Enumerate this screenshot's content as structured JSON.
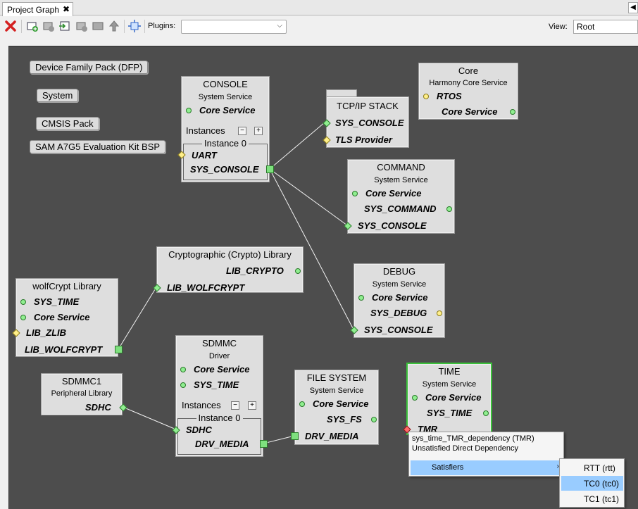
{
  "tab": {
    "title": "Project Graph",
    "close": "✖",
    "overflow": "◀"
  },
  "toolbar": {
    "plugins_label": "Plugins:",
    "plugins_value": "",
    "view_label": "View:",
    "view_value": "Root"
  },
  "top_pills": [
    "Device Family Pack (DFP)",
    "System",
    "CMSIS Pack",
    "SAM A7G5 Evaluation Kit BSP"
  ],
  "nodes": {
    "console": {
      "title": "CONSOLE",
      "subtitle": "System Service",
      "core": "Core Service",
      "instances": "Instances",
      "instance0": "Instance 0",
      "uart": "UART",
      "sys_console": "SYS_CONSOLE"
    },
    "tcpip": {
      "title": "TCP/IP STACK",
      "sys_console": "SYS_CONSOLE",
      "tls": "TLS Provider"
    },
    "core": {
      "title": "Core",
      "subtitle": "Harmony Core Service",
      "rtos": "RTOS",
      "core": "Core Service"
    },
    "command": {
      "title": "COMMAND",
      "subtitle": "System Service",
      "core": "Core Service",
      "sys_command": "SYS_COMMAND",
      "sys_console": "SYS_CONSOLE"
    },
    "crypto": {
      "title": "Cryptographic (Crypto) Library",
      "lib_crypto": "LIB_CRYPTO",
      "lib_wolfcrypt": "LIB_WOLFCRYPT"
    },
    "wolfcrypt": {
      "title": "wolfCrypt Library",
      "sys_time": "SYS_TIME",
      "core": "Core Service",
      "lib_zlib": "LIB_ZLIB",
      "lib_wolfcrypt": "LIB_WOLFCRYPT"
    },
    "debug": {
      "title": "DEBUG",
      "subtitle": "System Service",
      "core": "Core Service",
      "sys_debug": "SYS_DEBUG",
      "sys_console": "SYS_CONSOLE"
    },
    "sdmmc": {
      "title": "SDMMC",
      "subtitle": "Driver",
      "core": "Core Service",
      "sys_time": "SYS_TIME",
      "instances": "Instances",
      "instance0": "Instance 0",
      "sdhc": "SDHC",
      "drv_media": "DRV_MEDIA"
    },
    "sdmmc1": {
      "title": "SDMMC1",
      "subtitle": "Peripheral Library",
      "sdhc": "SDHC"
    },
    "filesystem": {
      "title": "FILE SYSTEM",
      "subtitle": "System Service",
      "core": "Core Service",
      "sys_fs": "SYS_FS",
      "drv_media": "DRV_MEDIA"
    },
    "time": {
      "title": "TIME",
      "subtitle": "System Service",
      "core": "Core Service",
      "sys_time": "SYS_TIME",
      "tmr": "TMR"
    }
  },
  "context_menu": {
    "line1": "sys_time_TMR_dependency (TMR)",
    "line2": "Unsatisfied Direct Dependency",
    "satisfiers": "Satisfiers",
    "arrow": "›",
    "submenu": [
      "RTT (rtt)",
      "TC0 (tc0)",
      "TC1 (tc1)"
    ]
  },
  "colors": {
    "canvas": "#4d4d4d",
    "node_bg": "#dedede",
    "port_green": "#90ee90",
    "port_yellow": "#ffef8a",
    "port_red": "#ff6b6b",
    "menu_highlight": "#99ccff"
  }
}
